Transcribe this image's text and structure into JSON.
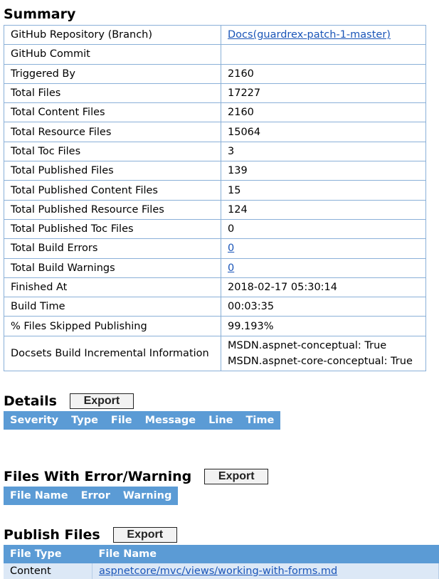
{
  "summary": {
    "title": "Summary",
    "rows": [
      {
        "key": "GitHub Repository (Branch)",
        "value": "Docs(guardrex-patch-1-master)",
        "link": true
      },
      {
        "key": "GitHub Commit",
        "value": ""
      },
      {
        "key": "Triggered By",
        "value": "2160"
      },
      {
        "key": "Total Files",
        "value": "17227"
      },
      {
        "key": "Total Content Files",
        "value": "2160"
      },
      {
        "key": "Total Resource Files",
        "value": "15064"
      },
      {
        "key": "Total Toc Files",
        "value": "3"
      },
      {
        "key": "Total Published Files",
        "value": "139"
      },
      {
        "key": "Total Published Content Files",
        "value": "15"
      },
      {
        "key": "Total Published Resource Files",
        "value": "124"
      },
      {
        "key": "Total Published Toc Files",
        "value": "0"
      },
      {
        "key": "Total Build Errors",
        "value": "0",
        "link": true
      },
      {
        "key": "Total Build Warnings",
        "value": "0",
        "link": true
      },
      {
        "key": "Finished At",
        "value": "2018-02-17 05:30:14"
      },
      {
        "key": "Build Time",
        "value": "00:03:35"
      },
      {
        "key": "% Files Skipped Publishing",
        "value": "99.193%"
      }
    ],
    "docsets": {
      "key": "Docsets Build Incremental Information",
      "line1": "MSDN.aspnet-conceptual: True",
      "line2": "MSDN.aspnet-core-conceptual: True"
    }
  },
  "details": {
    "title": "Details",
    "export_label": "Export",
    "columns": [
      "Severity",
      "Type",
      "File",
      "Message",
      "Line",
      "Time"
    ]
  },
  "files_with_errors": {
    "title": "Files With Error/Warning",
    "export_label": "Export",
    "columns": [
      "File Name",
      "Error",
      "Warning"
    ]
  },
  "publish_files": {
    "title": "Publish Files",
    "export_label": "Export",
    "columns": [
      "File Type",
      "File Name"
    ],
    "rows": [
      {
        "type": "Content",
        "name": "aspnetcore/mvc/views/working-with-forms.md"
      }
    ]
  }
}
